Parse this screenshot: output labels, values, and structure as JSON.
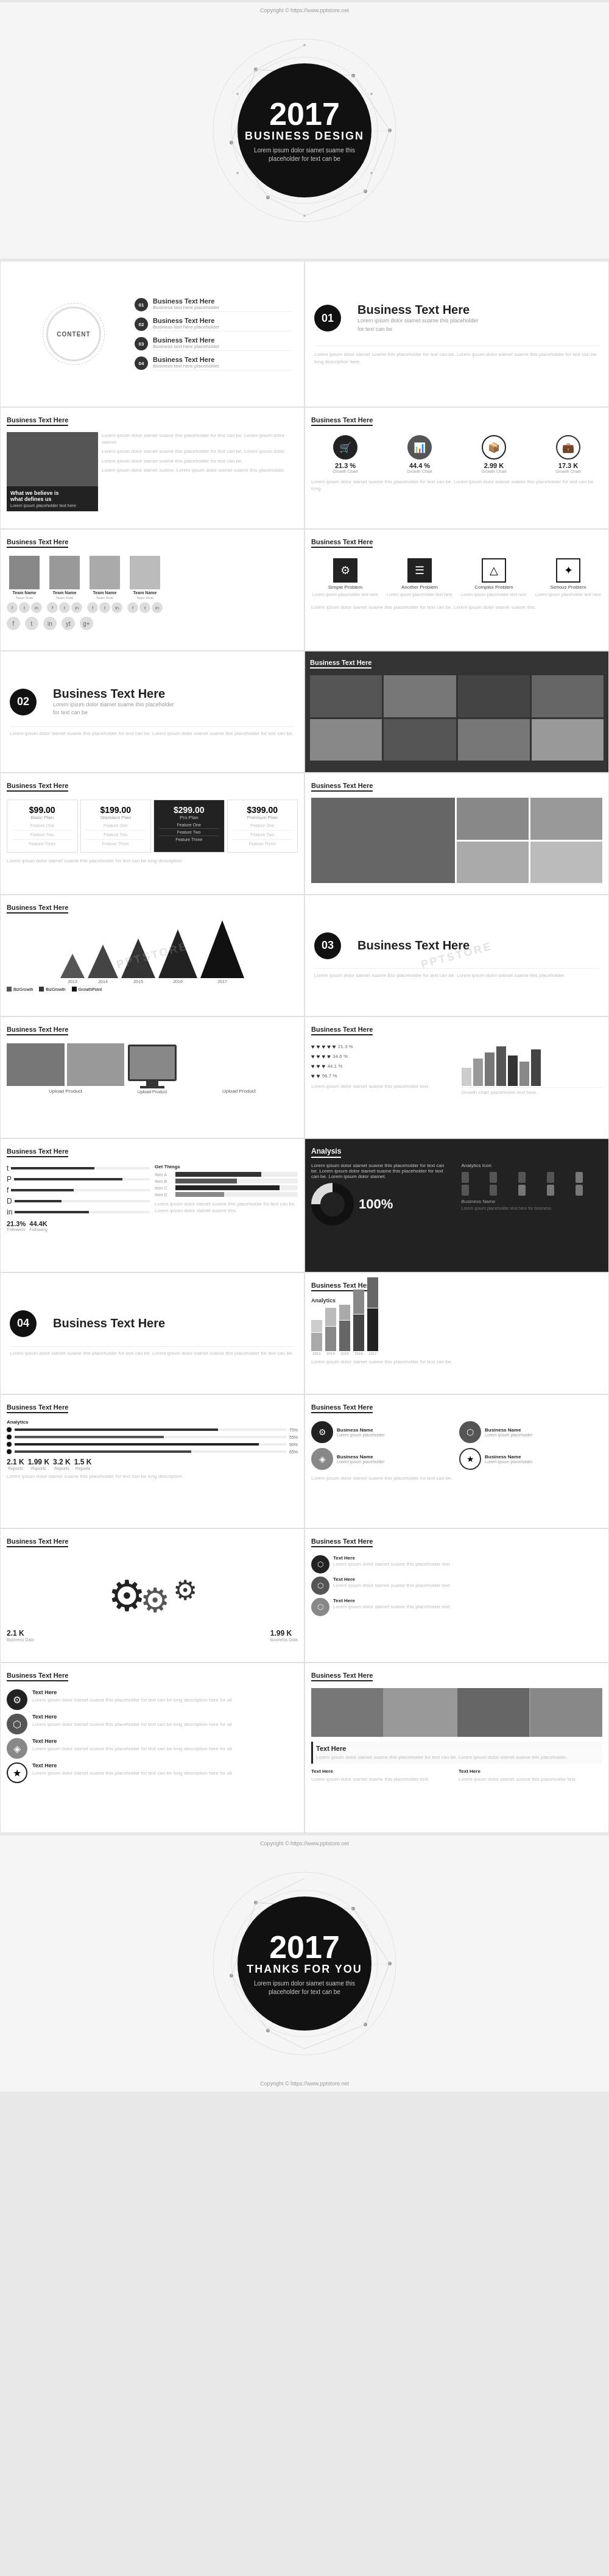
{
  "site": {
    "copyright": "Copyright © https://www.pptstore.net",
    "watermark": "PPTSTORE"
  },
  "slide1": {
    "year": "2017",
    "title": "BUSINESS DESIGN",
    "subtitle": "Lorem ipsum dolor siamet suame this placeholder for text can be"
  },
  "content_slide": {
    "heading": "CONTENT",
    "items": [
      {
        "num": "01",
        "title": "Business Text Here",
        "sub": "Business text here placeholder"
      },
      {
        "num": "02",
        "title": "Business Text Here",
        "sub": "Business text here placeholder"
      },
      {
        "num": "03",
        "title": "Business Text Here",
        "sub": "Business text here placeholder"
      },
      {
        "num": "04",
        "title": "Business Text Here",
        "sub": "Business text here placeholder"
      }
    ]
  },
  "slide_01": {
    "num": "01",
    "title": "Business Text Here",
    "sub": "Lorem ipsum dolor siamet suame this placeholder for text can be"
  },
  "sections": {
    "business_text_here": "Business Text Here",
    "placeholder_long": "Lorem ipsum dolor siamet suame this placeholder for text can be. Lorem ipsum dolor siamet suame this.",
    "placeholder_short": "Lorem ipsum dolor siamet."
  },
  "stats": {
    "s1": "21.3 %",
    "s2": "44.4 %",
    "s3": "2.99 K",
    "s4": "17.3 K"
  },
  "prices": {
    "p1": "$99.00",
    "p2": "$199.00",
    "p3": "$299.00",
    "p4": "$399.00"
  },
  "features": {
    "f1": "Simple Problem",
    "f2": "Another Problem",
    "f3": "Complex Problem",
    "f4": "Serious Problem"
  },
  "slide_02": {
    "num": "02",
    "title": "Business Text Here",
    "sub": "Lorem ipsum dolor siamet suame this placeholder for text can be"
  },
  "slide_03": {
    "num": "03",
    "title": "Business Text Here"
  },
  "slide_04": {
    "num": "04",
    "title": "Business Text Here"
  },
  "text_here": "Text Here",
  "analysis": "Analysis",
  "percent_100": "100%",
  "thanks_slide": {
    "year": "2017",
    "title": "THANKS FOR YOU",
    "subtitle": "Lorem ipsum dolor siamet suame this placeholder for text can be"
  }
}
